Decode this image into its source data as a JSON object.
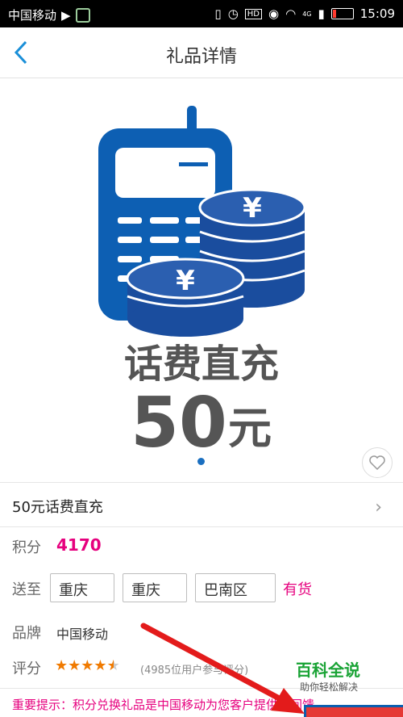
{
  "status_bar": {
    "carrier": "中国移动",
    "network_label": "4G",
    "time": "15:09",
    "icons": [
      "play-icon",
      "app-icon",
      "vibrate-icon",
      "alarm-icon",
      "hd-icon",
      "eye-icon",
      "wifi-icon",
      "signal-icon",
      "battery-icon"
    ]
  },
  "header": {
    "title": "礼品详情",
    "back_icon": "chevron-left-icon"
  },
  "banner": {
    "line1": "话费直充",
    "amount": "50",
    "unit": "元",
    "coin_symbol": "¥",
    "colors": {
      "phone": "#0d5fb3",
      "coin": "#1a4d9e",
      "text": "#555555"
    }
  },
  "product": {
    "name": "50元话费直充"
  },
  "points": {
    "label": "积分",
    "value": "4170"
  },
  "delivery": {
    "label": "送至",
    "province": "重庆",
    "city": "重庆",
    "district": "巴南区",
    "stock": "有货"
  },
  "brand": {
    "label": "品牌",
    "value": "中国移动"
  },
  "rating": {
    "label": "评分",
    "stars": 4.5,
    "count_text": "(4985位用户参与评分)"
  },
  "notice": {
    "text": "重要提示：积分兑换礼品是中国移动为您客户提供的回馈"
  },
  "watermark": {
    "title": "百科全说",
    "subtitle": "助你轻松解决"
  },
  "accent_colors": {
    "primary": "#1a6fc0",
    "points": "#e6007e",
    "star": "#f07a00",
    "arrow": "#e31b1b"
  }
}
